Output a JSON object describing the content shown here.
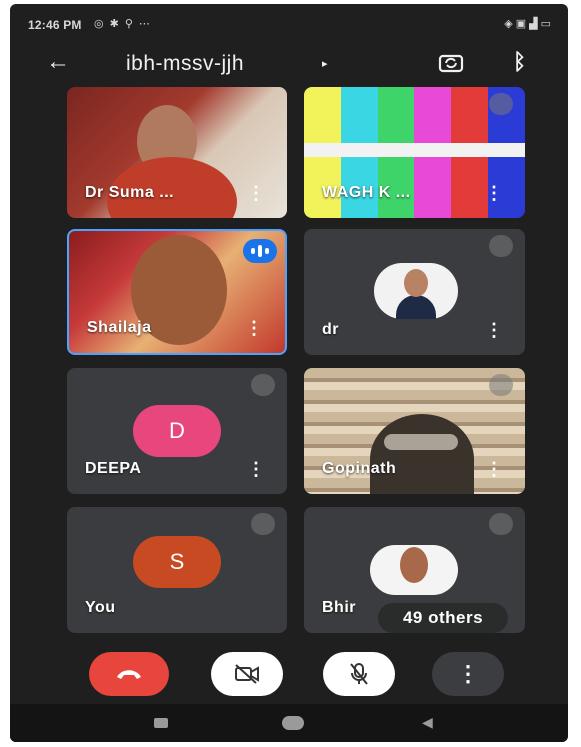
{
  "status_bar": {
    "time": "12:46 PM",
    "left_icons": [
      "whatsapp-icon",
      "settings-icon",
      "location-icon",
      "more-dots-icon"
    ],
    "right_icons": [
      "signal-icon",
      "network-icon",
      "wifi-icon",
      "battery-icon"
    ]
  },
  "header": {
    "meeting_code": "ibh-mssv-jjh",
    "icons": [
      "back-arrow-icon",
      "caret-right-icon",
      "switch-camera-icon",
      "bluetooth-icon"
    ]
  },
  "participants": [
    {
      "name": "Dr Suma ...",
      "type": "video"
    },
    {
      "name": "WAGH K ...",
      "type": "video",
      "muted": true
    },
    {
      "name": "Shailaja",
      "type": "video",
      "speaking": true
    },
    {
      "name": "dr",
      "type": "photo",
      "muted": true
    },
    {
      "name": "DEEPA",
      "type": "initial",
      "initial": "D",
      "avatar_color": "#e8477d",
      "muted": true
    },
    {
      "name": "Gopinath",
      "type": "video",
      "muted": true
    },
    {
      "name": "You",
      "type": "initial",
      "initial": "S",
      "avatar_color": "#c84a22",
      "muted": true
    },
    {
      "name": "Bhir",
      "type": "photo",
      "muted": true
    }
  ],
  "others_label": "49 others",
  "controls": {
    "icons": [
      "end-call-icon",
      "camera-off-icon",
      "mic-off-icon",
      "more-options-icon"
    ],
    "colors": {
      "end_call": "#e8453c",
      "toggle": "#ffffff",
      "more": "#3c3d40"
    }
  },
  "nav_bar": {
    "icons": [
      "recents-icon",
      "home-icon",
      "back-icon"
    ]
  }
}
